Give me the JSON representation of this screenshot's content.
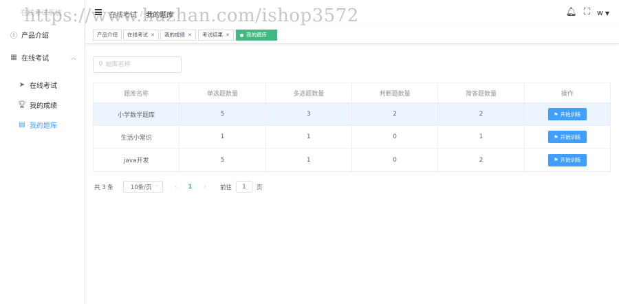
{
  "app": {
    "logo_text": "在线考试系统"
  },
  "sidebar": {
    "items": [
      {
        "label": "产品介绍",
        "icon": "info-circle-icon"
      },
      {
        "label": "在线考试",
        "icon": "grid-icon"
      },
      {
        "label": "在线考试",
        "icon": "send-icon"
      },
      {
        "label": "我的成绩",
        "icon": "trophy-icon"
      },
      {
        "label": "我的题库",
        "icon": "notebook-icon"
      }
    ]
  },
  "header": {
    "breadcrumb": [
      "在线考试",
      "我的题库"
    ],
    "user": "w"
  },
  "tags": [
    {
      "label": "产品介绍"
    },
    {
      "label": "在线考试"
    },
    {
      "label": "我的成绩"
    },
    {
      "label": "考试结果"
    },
    {
      "label": "我的题库"
    }
  ],
  "search": {
    "placeholder": "题库名称",
    "value": ""
  },
  "table": {
    "columns": [
      "题库名称",
      "单选题数量",
      "多选题数量",
      "判断题数量",
      "简答题数量",
      "操作"
    ],
    "rows": [
      {
        "name": "小学数学题库",
        "single": "5",
        "multi": "3",
        "judge": "2",
        "short": "2",
        "action": "开始训练"
      },
      {
        "name": "生活小常识",
        "single": "1",
        "multi": "1",
        "judge": "0",
        "short": "1",
        "action": "开始训练"
      },
      {
        "name": "java开发",
        "single": "5",
        "multi": "1",
        "judge": "0",
        "short": "2",
        "action": "开始训练"
      }
    ]
  },
  "pagination": {
    "total": "共 3 条",
    "page_size": "10条/页",
    "current": "1",
    "goto_prefix": "前往",
    "goto_value": "1",
    "goto_suffix": "页"
  },
  "watermark": "https://www.huzhan.com/ishop3572",
  "colors": {
    "primary": "#409eff",
    "active_tag": "#42b983",
    "row_highlight": "#ecf5ff"
  }
}
